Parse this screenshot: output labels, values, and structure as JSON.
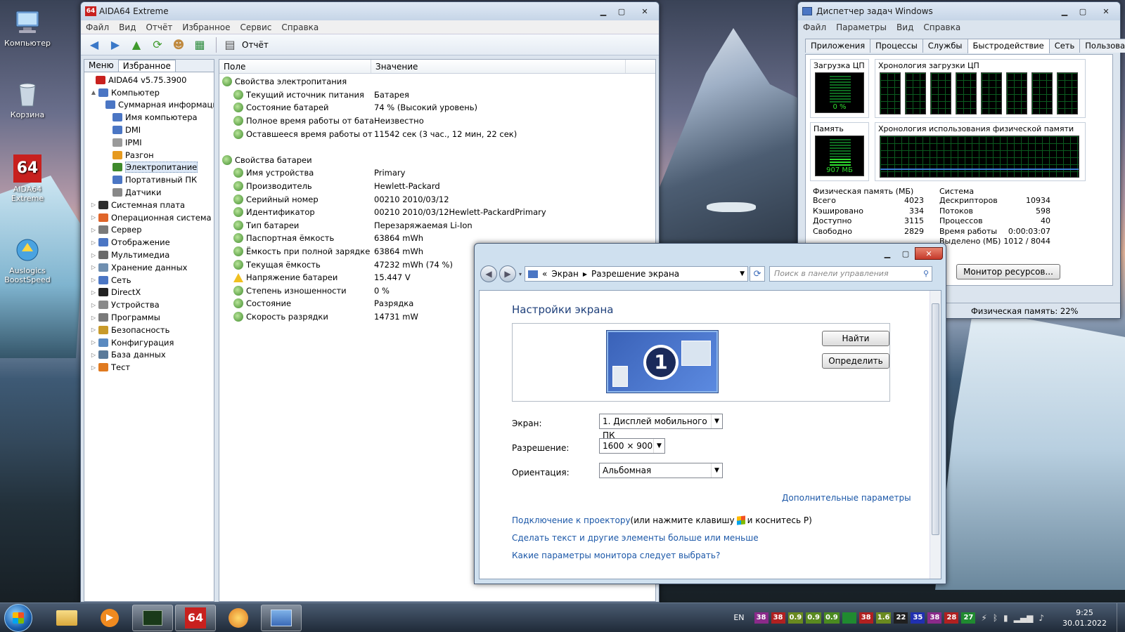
{
  "desktop": {
    "icons": [
      {
        "label": "Компьютер",
        "name": "computer"
      },
      {
        "label": "Корзина",
        "name": "recycle-bin"
      },
      {
        "label": "AIDA64 Extreme",
        "name": "aida64"
      },
      {
        "label": "Auslogics BoostSpeed",
        "name": "auslogics"
      }
    ]
  },
  "aida": {
    "title": "AIDA64 Extreme",
    "logo": "64",
    "menu": [
      "Файл",
      "Вид",
      "Отчёт",
      "Избранное",
      "Сервис",
      "Справка"
    ],
    "toolbar_report": "Отчёт",
    "tabs": [
      "Меню",
      "Избранное"
    ],
    "tree": [
      {
        "label": "AIDA64 v5.75.3900",
        "level": 0,
        "exp": "",
        "color": "#c8201e"
      },
      {
        "label": "Компьютер",
        "level": 1,
        "exp": "▲",
        "color": "#4b76c4"
      },
      {
        "label": "Суммарная информация",
        "level": 2,
        "exp": "",
        "color": "#4b76c4"
      },
      {
        "label": "Имя компьютера",
        "level": 2,
        "exp": "",
        "color": "#4b76c4"
      },
      {
        "label": "DMI",
        "level": 2,
        "exp": "",
        "color": "#4b76c4"
      },
      {
        "label": "IPMI",
        "level": 2,
        "exp": "",
        "color": "#9a9a9a"
      },
      {
        "label": "Разгон",
        "level": 2,
        "exp": "",
        "color": "#e69a1f"
      },
      {
        "label": "Электропитание",
        "level": 2,
        "exp": "",
        "color": "#3f8a2c",
        "selected": true
      },
      {
        "label": "Портативный ПК",
        "level": 2,
        "exp": "",
        "color": "#4b76c4"
      },
      {
        "label": "Датчики",
        "level": 2,
        "exp": "",
        "color": "#888888"
      },
      {
        "label": "Системная плата",
        "level": 1,
        "exp": "▷",
        "color": "#2d2d2d"
      },
      {
        "label": "Операционная система",
        "level": 1,
        "exp": "▷",
        "color": "#e0652a"
      },
      {
        "label": "Сервер",
        "level": 1,
        "exp": "▷",
        "color": "#7a7a7a"
      },
      {
        "label": "Отображение",
        "level": 1,
        "exp": "▷",
        "color": "#4b76c4"
      },
      {
        "label": "Мультимедиа",
        "level": 1,
        "exp": "▷",
        "color": "#6a6a6a"
      },
      {
        "label": "Хранение данных",
        "level": 1,
        "exp": "▷",
        "color": "#6f8fb0"
      },
      {
        "label": "Сеть",
        "level": 1,
        "exp": "▷",
        "color": "#4b76c4"
      },
      {
        "label": "DirectX",
        "level": 1,
        "exp": "▷",
        "color": "#222222"
      },
      {
        "label": "Устройства",
        "level": 1,
        "exp": "▷",
        "color": "#8a8a8a"
      },
      {
        "label": "Программы",
        "level": 1,
        "exp": "▷",
        "color": "#7a7a7a"
      },
      {
        "label": "Безопасность",
        "level": 1,
        "exp": "▷",
        "color": "#c89a2a"
      },
      {
        "label": "Конфигурация",
        "level": 1,
        "exp": "▷",
        "color": "#5a8ac0"
      },
      {
        "label": "База данных",
        "level": 1,
        "exp": "▷",
        "color": "#5a7a9a"
      },
      {
        "label": "Тест",
        "level": 1,
        "exp": "▷",
        "color": "#e07a20"
      }
    ],
    "columns": [
      "Поле",
      "Значение"
    ],
    "rows": [
      {
        "field": "Свойства электропитания",
        "value": "",
        "group": true
      },
      {
        "field": "Текущий источник питания",
        "value": "Батарея"
      },
      {
        "field": "Состояние батарей",
        "value": "74 % (Высокий уровень)"
      },
      {
        "field": "Полное время работы от бата...",
        "value": "Неизвестно"
      },
      {
        "field": "Оставшееся время работы от ...",
        "value": "11542 сек (3 час., 12 мин, 22 сек)"
      },
      {
        "field": "",
        "value": "",
        "spacer": true
      },
      {
        "field": "Свойства батареи",
        "value": "",
        "group": true
      },
      {
        "field": "Имя устройства",
        "value": "Primary"
      },
      {
        "field": "Производитель",
        "value": "Hewlett-Packard"
      },
      {
        "field": "Серийный номер",
        "value": "00210 2010/03/12"
      },
      {
        "field": "Идентификатор",
        "value": "00210 2010/03/12Hewlett-PackardPrimary"
      },
      {
        "field": "Тип батареи",
        "value": "Перезаряжаемая Li-Ion"
      },
      {
        "field": "Паспортная ёмкость",
        "value": "63864 mWh"
      },
      {
        "field": "Ёмкость при полной зарядке",
        "value": "63864 mWh"
      },
      {
        "field": "Текущая ёмкость",
        "value": "47232 mWh  (74 %)"
      },
      {
        "field": "Напряжение батареи",
        "value": "15.447 V",
        "warn": true
      },
      {
        "field": "Степень изношенности",
        "value": "0 %"
      },
      {
        "field": "Состояние",
        "value": "Разрядка"
      },
      {
        "field": "Скорость разрядки",
        "value": "14731 mW"
      }
    ]
  },
  "taskmgr": {
    "title": "Диспетчер задач Windows",
    "menu": [
      "Файл",
      "Параметры",
      "Вид",
      "Справка"
    ],
    "tabs": [
      "Приложения",
      "Процессы",
      "Службы",
      "Быстродействие",
      "Сеть",
      "Пользователи"
    ],
    "active_tab": 3,
    "cpu_label": "Загрузка ЦП",
    "cpu_value": "0 %",
    "cpu_history_label": "Хронология загрузки ЦП",
    "mem_label": "Память",
    "mem_value": "907 МБ",
    "mem_history_label": "Хронология использования физической памяти",
    "phys_title": "Физическая память (МБ)",
    "phys": [
      {
        "k": "Всего",
        "v": "4023"
      },
      {
        "k": "Кэшировано",
        "v": "334"
      },
      {
        "k": "Доступно",
        "v": "3115"
      },
      {
        "k": "Свободно",
        "v": "2829"
      }
    ],
    "sys_title": "Система",
    "sys": [
      {
        "k": "Дескрипторов",
        "v": "10934"
      },
      {
        "k": "Потоков",
        "v": "598"
      },
      {
        "k": "Процессов",
        "v": "40"
      },
      {
        "k": "Время работы",
        "v": "0:00:03:07"
      },
      {
        "k": "Выделено (МБ)",
        "v": "1012 / 8044"
      }
    ],
    "resmon_button": "Монитор ресурсов...",
    "status": "Физическая память: 22%"
  },
  "display": {
    "breadcrumb_prefix": "«",
    "breadcrumb": [
      "Экран",
      "Разрешение экрана"
    ],
    "search_placeholder": "Поиск в панели управления",
    "heading": "Настройки экрана",
    "monitor_number": "1",
    "find_button": "Найти",
    "identify_button": "Определить",
    "screen_label": "Экран:",
    "screen_value": "1. Дисплей мобильного ПК",
    "resolution_label": "Разрешение:",
    "resolution_value": "1600 × 900",
    "orientation_label": "Ориентация:",
    "orientation_value": "Альбомная",
    "advanced_link": "Дополнительные параметры",
    "projector_link": "Подключение к проектору",
    "projector_text1": " (или нажмите клавишу ",
    "projector_text2": " и коснитесь P)",
    "text_size_link": "Сделать текст и другие элементы больше или меньше",
    "monitor_link": "Какие параметры монитора следует выбрать?"
  },
  "taskbar": {
    "lang": "EN",
    "time": "9:25",
    "date": "30.01.2022",
    "badges": [
      {
        "t": "38",
        "c": "#8a2a8a"
      },
      {
        "t": "38",
        "c": "#b02020"
      },
      {
        "t": "0.9",
        "c": "#6a8a20"
      },
      {
        "t": "0.9",
        "c": "#5a8a20"
      },
      {
        "t": "0.9",
        "c": "#4a8a20"
      },
      {
        "t": "",
        "c": "#208a30"
      },
      {
        "t": "38",
        "c": "#b02020"
      },
      {
        "t": "1.6",
        "c": "#6a8a20"
      },
      {
        "t": "22",
        "c": "#202020"
      },
      {
        "t": "35",
        "c": "#2030b0"
      },
      {
        "t": "38",
        "c": "#8a2a8a"
      },
      {
        "t": "28",
        "c": "#b02020"
      },
      {
        "t": "27",
        "c": "#208a30"
      }
    ]
  }
}
